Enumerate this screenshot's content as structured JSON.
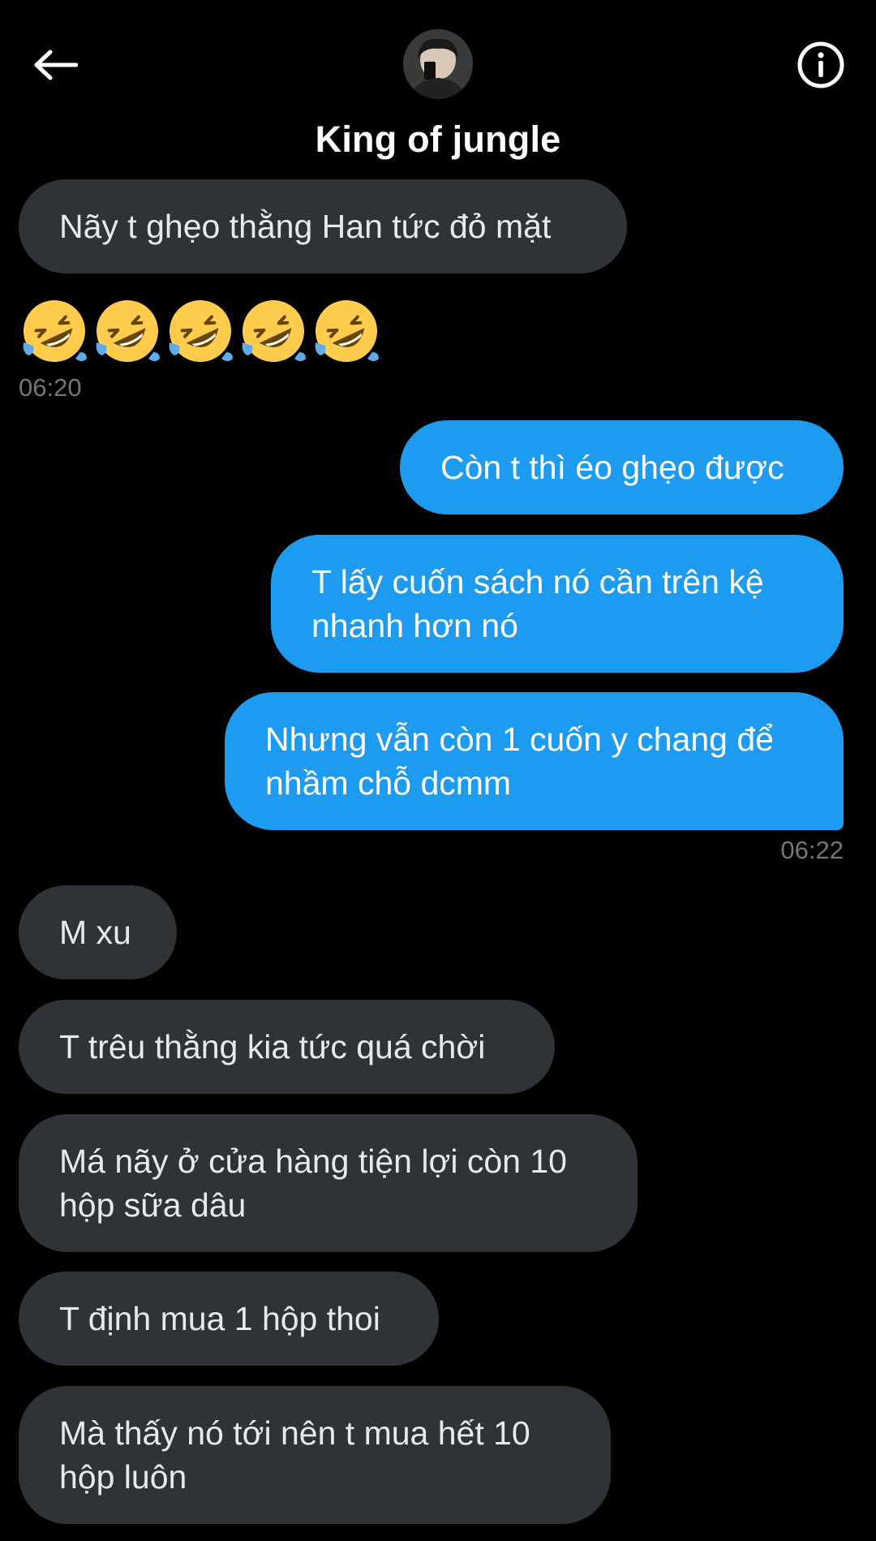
{
  "header": {
    "title": "King of jungle",
    "back_icon": "arrow-left-icon",
    "info_icon": "info-circle-icon"
  },
  "colors": {
    "background": "#000000",
    "incoming_bubble": "#2f3336",
    "outgoing_bubble": "#1d9bf0",
    "timestamp": "#71767b"
  },
  "messages": [
    {
      "dir": "in",
      "text": "Nãy t ghẹo thằng Han tức đỏ mặt"
    },
    {
      "dir": "in",
      "emoji": "rolling-on-floor-laughing",
      "count": 5
    },
    {
      "dir": "out",
      "text": "Còn t thì éo ghẹo được"
    },
    {
      "dir": "out",
      "text": "T lấy cuốn sách nó cần trên kệ nhanh hơn nó"
    },
    {
      "dir": "out",
      "text": "Nhưng vẫn còn 1 cuốn y chang để nhầm chỗ dcmm"
    },
    {
      "dir": "in",
      "text": "M xu"
    },
    {
      "dir": "in",
      "text": "T trêu thằng kia tức quá chời"
    },
    {
      "dir": "in",
      "text": "Má nãy ở cửa hàng tiện lợi còn 10 hộp sữa dâu"
    },
    {
      "dir": "in",
      "text": "T định mua 1 hộp thoi"
    },
    {
      "dir": "in",
      "text": "Mà thấy nó tới nên t mua hết 10 hộp luôn"
    }
  ],
  "timestamps": [
    "06:20",
    "06:22"
  ]
}
